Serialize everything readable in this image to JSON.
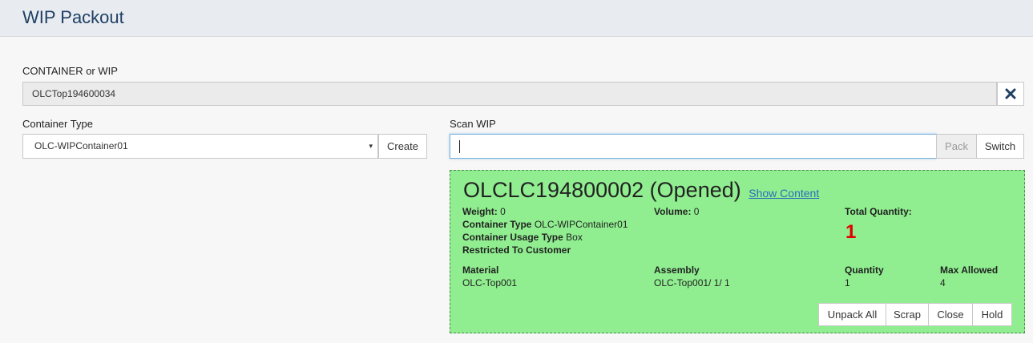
{
  "page": {
    "title": "WIP Packout"
  },
  "container_or_wip": {
    "label": "CONTAINER or WIP",
    "value": "OLCTop194600034",
    "clear_icon": "close-x-icon"
  },
  "container_type": {
    "label": "Container Type",
    "selected": "OLC-WIPContainer01",
    "caret": "▾",
    "create_label": "Create"
  },
  "scan_wip": {
    "label": "Scan WIP",
    "value": "",
    "pack_label": "Pack",
    "switch_label": "Switch"
  },
  "container_panel": {
    "title": "OLCLC194800002 (Opened)",
    "show_content_link": "Show Content",
    "weight_label": "Weight:",
    "weight_value": "0",
    "volume_label": "Volume:",
    "volume_value": "0",
    "total_qty_label": "Total Quantity:",
    "total_qty_value": "1",
    "container_type_label": "Container Type",
    "container_type_value": "OLC-WIPContainer01",
    "usage_type_label": "Container Usage Type",
    "usage_type_value": "Box",
    "restricted_label": "Restricted To Customer",
    "columns": {
      "material": {
        "header": "Material",
        "value": "OLC-Top001"
      },
      "assembly": {
        "header": "Assembly",
        "value": "OLC-Top001/ 1/ 1"
      },
      "quantity": {
        "header": "Quantity",
        "value": "1"
      },
      "max_allowed": {
        "header": "Max Allowed",
        "value": "4"
      }
    },
    "actions": [
      "Unpack All",
      "Scrap",
      "Close",
      "Hold"
    ],
    "background": "#90ee90"
  },
  "colors": {
    "title": "#1f3f63",
    "accent_red": "#e00000",
    "link": "#2a6ebb"
  }
}
